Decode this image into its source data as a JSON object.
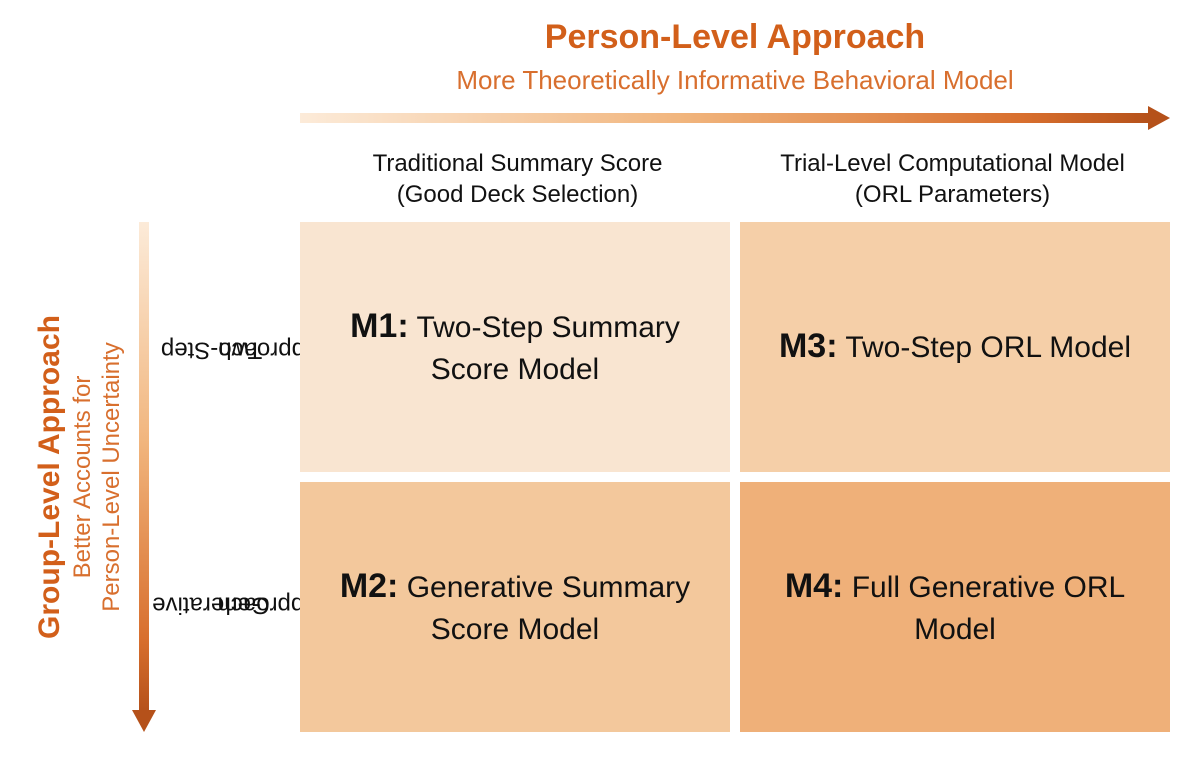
{
  "top": {
    "title": "Person-Level Approach",
    "sub": "More Theoretically Informative Behavioral Model"
  },
  "left": {
    "title": "Group-Level  Approach",
    "sub_line1": "Better Accounts for",
    "sub_line2": "Person-Level Uncertainty"
  },
  "cols": {
    "c1_l1": "Traditional Summary Score",
    "c1_l2": "(Good Deck Selection)",
    "c2_l1": "Trial-Level Computational Model",
    "c2_l2": "(ORL Parameters)"
  },
  "rows": {
    "r1_l1": "Two-Step",
    "r1_l2": "Approach",
    "r2_l1": "Generative",
    "r2_l2": "Approach"
  },
  "cells": {
    "m1": {
      "code": "M1:",
      "text": " Two-Step Summary Score Model"
    },
    "m2": {
      "code": "M2:",
      "text": " Generative Summary Score Model"
    },
    "m3": {
      "code": "M3:",
      "text": " Two-Step ORL Model"
    },
    "m4": {
      "code": "M4:",
      "text": " Full Generative ORL Model"
    }
  }
}
